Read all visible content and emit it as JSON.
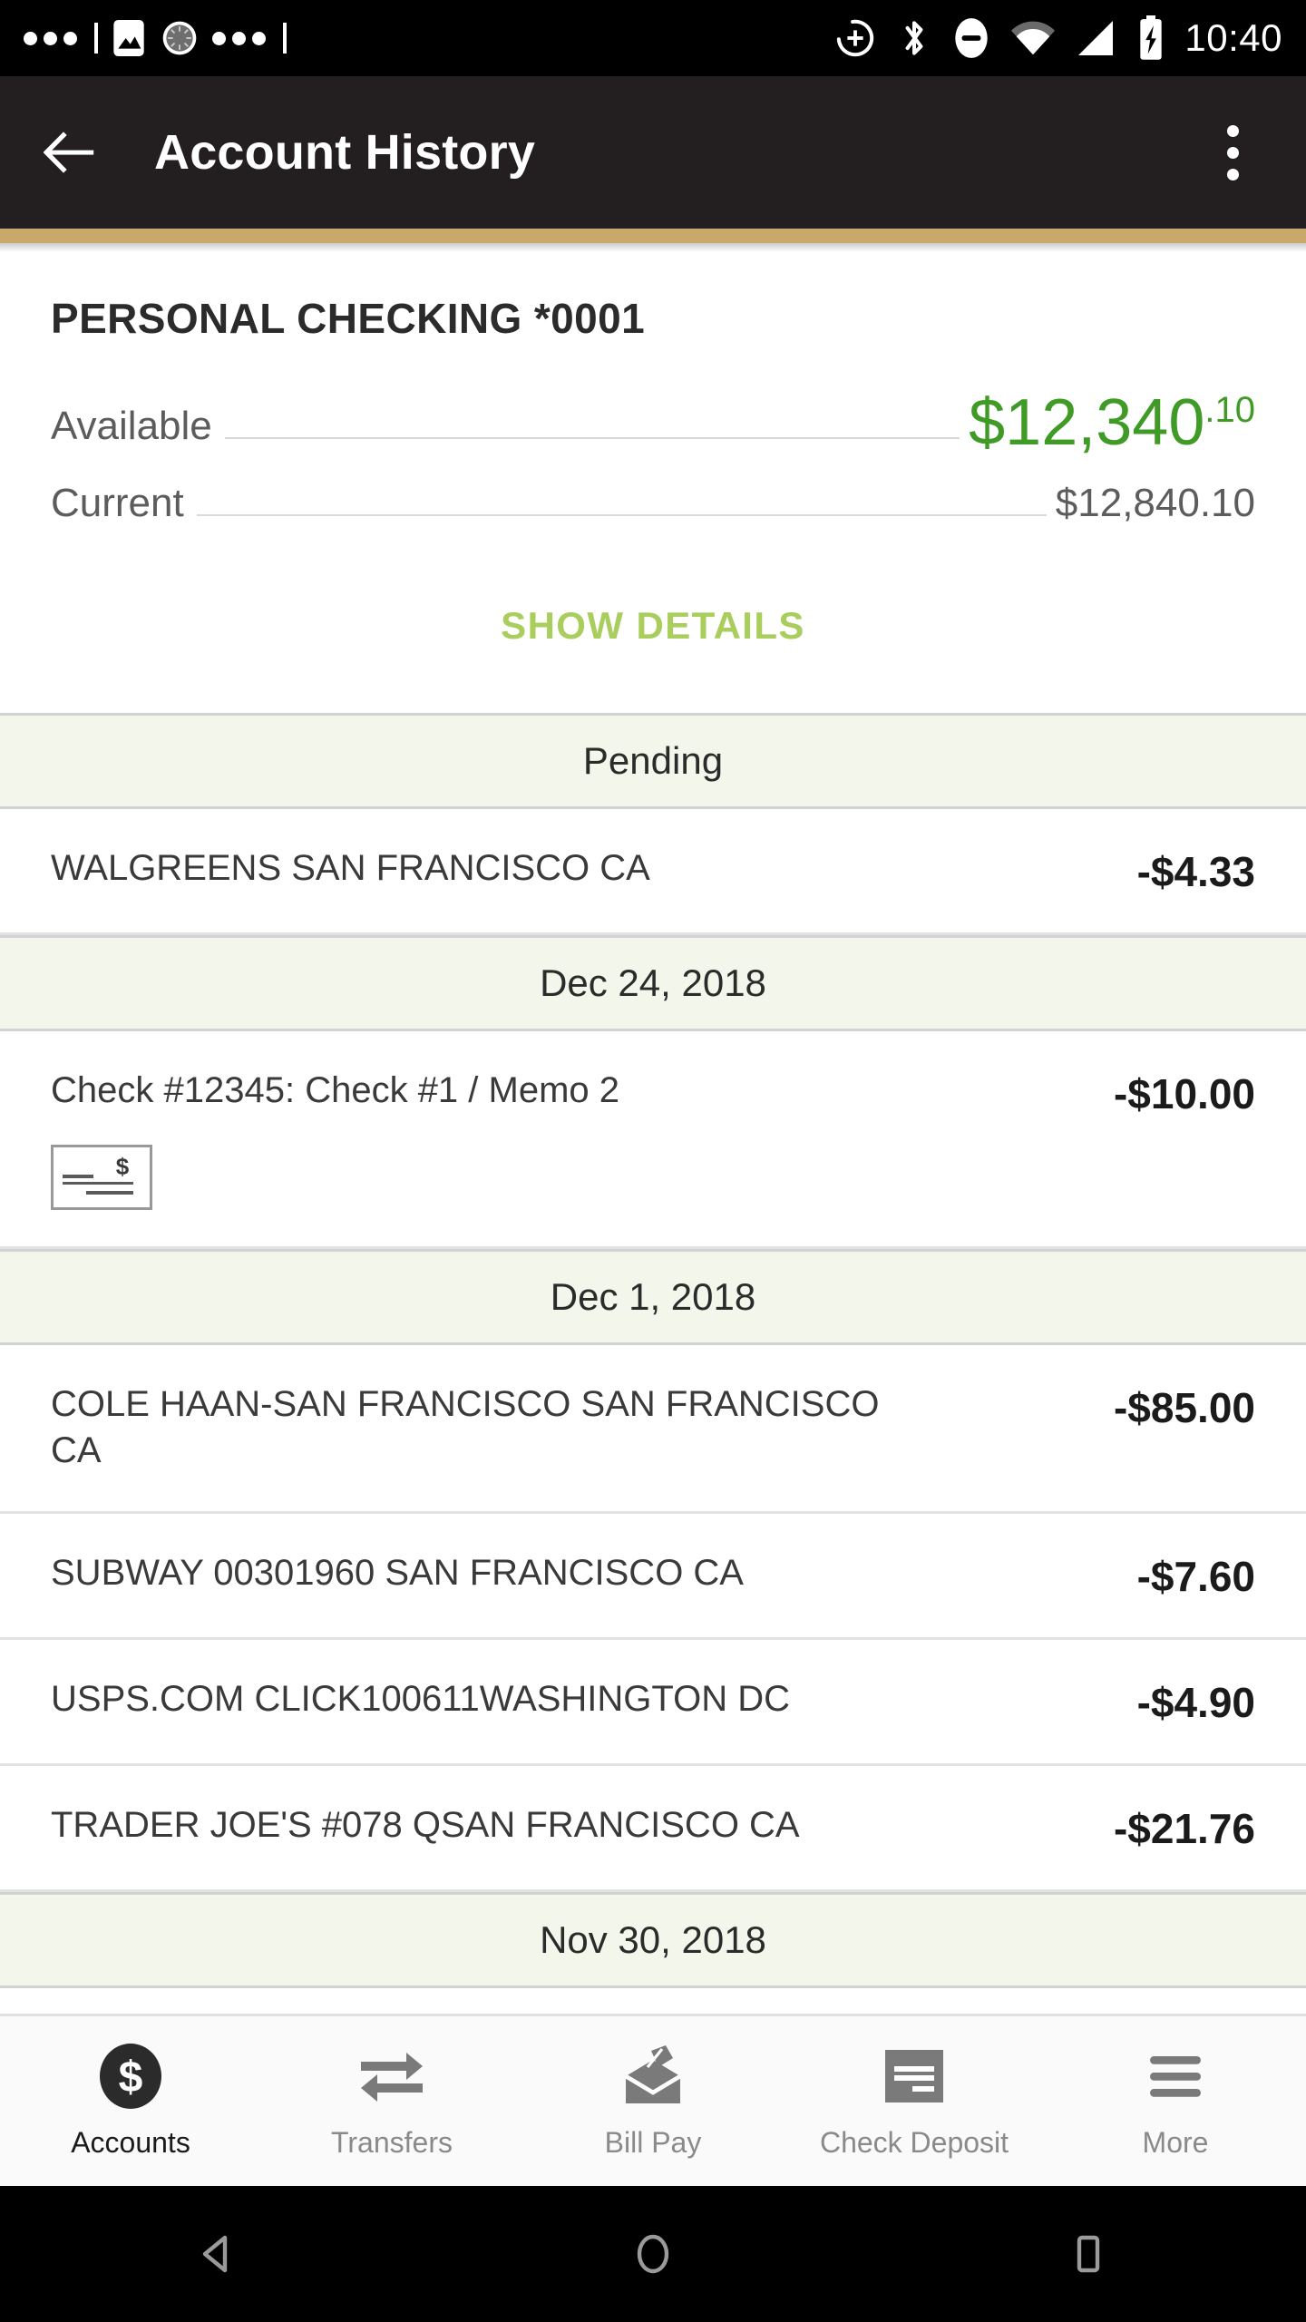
{
  "status_bar": {
    "time": "10:40",
    "left_icons": [
      "more-dots-icon",
      "image-icon",
      "spinner-icon",
      "more-dots-icon"
    ],
    "right_icons": [
      "location-add-icon",
      "bluetooth-icon",
      "do-not-disturb-icon",
      "wifi-icon",
      "cellular-signal-icon",
      "battery-charging-icon"
    ]
  },
  "app_bar": {
    "title": "Account History",
    "back_icon": "back-arrow-icon",
    "overflow_icon": "overflow-menu-icon",
    "accent_color": "#c8a86b",
    "background_color": "#231f20"
  },
  "account": {
    "name": "PERSONAL CHECKING *0001",
    "available_label": "Available",
    "available_amount": "$12,340",
    "available_cents": ".10",
    "available_color": "#3f9a26",
    "current_label": "Current",
    "current_amount": "$12,840.10",
    "show_details_label": "SHOW DETAILS",
    "show_details_color": "#a9ce5d"
  },
  "sections": [
    {
      "header": "Pending",
      "transactions": [
        {
          "description": "WALGREENS SAN FRANCISCO CA",
          "amount": "-$4.33",
          "has_check_image": false
        }
      ]
    },
    {
      "header": "Dec 24, 2018",
      "transactions": [
        {
          "description": "Check #12345: Check #1 / Memo 2",
          "amount": "-$10.00",
          "has_check_image": true,
          "check_icon": "check-thumbnail-icon"
        }
      ]
    },
    {
      "header": "Dec 1, 2018",
      "transactions": [
        {
          "description": "COLE HAAN-SAN FRANCISCO SAN FRANCISCO CA",
          "amount": "-$85.00",
          "has_check_image": false
        },
        {
          "description": "SUBWAY 00301960 SAN FRANCISCO CA",
          "amount": "-$7.60",
          "has_check_image": false
        },
        {
          "description": "USPS.COM CLICK100611WASHINGTON DC",
          "amount": "-$4.90",
          "has_check_image": false
        },
        {
          "description": "TRADER JOE'S #078 QSAN FRANCISCO CA",
          "amount": "-$21.76",
          "has_check_image": false
        }
      ]
    },
    {
      "header": "Nov 30, 2018",
      "transactions": []
    }
  ],
  "tab_bar": {
    "items": [
      {
        "label": "Accounts",
        "icon": "dollar-circle-icon",
        "active": true
      },
      {
        "label": "Transfers",
        "icon": "transfer-arrows-icon",
        "active": false
      },
      {
        "label": "Bill Pay",
        "icon": "envelope-pen-icon",
        "active": false
      },
      {
        "label": "Check Deposit",
        "icon": "check-deposit-icon",
        "active": false
      },
      {
        "label": "More",
        "icon": "hamburger-menu-icon",
        "active": false
      }
    ]
  },
  "nav_bar": {
    "back": "android-back-icon",
    "home": "android-home-icon",
    "recents": "android-recents-icon"
  }
}
